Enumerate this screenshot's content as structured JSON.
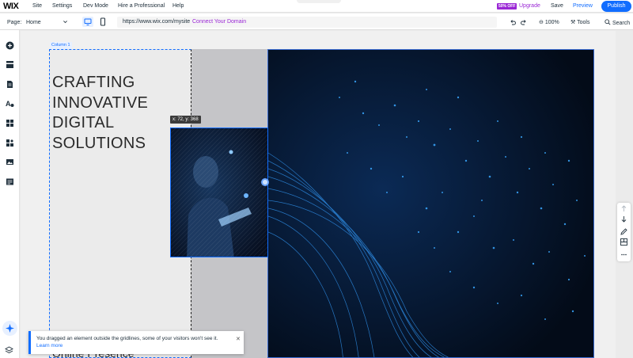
{
  "topbar": {
    "logo": "WIX",
    "menu": [
      "Site",
      "Settings",
      "Dev Mode",
      "Hire a Professional",
      "Help"
    ],
    "badge": "50% OFF",
    "upgrade": "Upgrade",
    "save": "Save",
    "preview": "Preview",
    "publish": "Publish"
  },
  "toolbar": {
    "page_label": "Page:",
    "page_value": "Home",
    "url": "https://www.wix.com/mysite",
    "connect_domain": "Connect Your Domain",
    "zoom": "100%",
    "tools": "Tools",
    "search": "Search"
  },
  "canvas": {
    "column_tag": "Column 1",
    "headline": [
      "CRAFTING",
      "INNOVATIVE",
      "DIGITAL",
      "SOLUTIONS"
    ],
    "coords": "x: 72, y: 368",
    "bottom_text": "Online Presence"
  },
  "toast": {
    "message": "You dragged an element outside the gridlines, some of your visitors won't see it.",
    "link": "Learn more"
  },
  "colors": {
    "accent": "#116dff",
    "upgrade": "#9a27d5",
    "dark_section": "#030b18"
  },
  "icons": {
    "left": [
      "add-icon",
      "sections-icon",
      "pages-icon",
      "design-icon",
      "apps-icon",
      "business-icon",
      "media-icon",
      "cms-icon",
      "ai-assistant-icon",
      "layers-icon"
    ],
    "right": [
      "move-up-icon",
      "move-down-icon",
      "edit-icon",
      "layout-icon",
      "more-icon"
    ]
  }
}
